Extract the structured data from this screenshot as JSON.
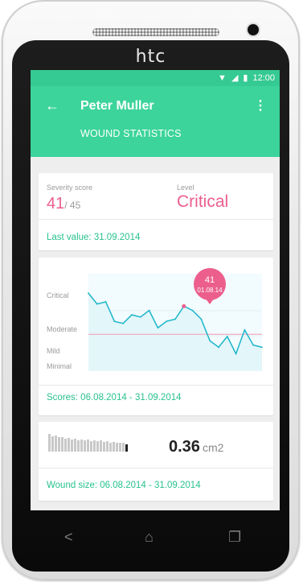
{
  "device": {
    "brand": "htc"
  },
  "status_bar": {
    "time": "12:00"
  },
  "app_bar": {
    "back_icon": "arrow-left-icon",
    "title": "Peter Muller",
    "subtitle": "WOUND STATISTICS",
    "menu_icon": "more-vert-icon"
  },
  "severity_card": {
    "severity_label": "Severity score",
    "score": "41",
    "score_max": "/ 45",
    "level_label": "Level",
    "level_value": "Critical",
    "footer": "Last value: 31.09.2014"
  },
  "chart_card": {
    "footer": "Scores: 06.08.2014 - 31.09.2014",
    "tooltip_value": "41",
    "tooltip_date": "01.08.14"
  },
  "chart_data": {
    "type": "area",
    "y_categories": [
      "Critical",
      "Moderate",
      "Mild",
      "Minimal"
    ],
    "ylim": [
      0,
      45
    ],
    "threshold": 17,
    "values": [
      36,
      31,
      32,
      23,
      22,
      26,
      25,
      28,
      20,
      23,
      24,
      30,
      28,
      24,
      14,
      11,
      16,
      8,
      19,
      12,
      11
    ],
    "highlight_index": 11,
    "colors": {
      "line": "#1ab6c9",
      "fill": "#e3f6fa",
      "threshold": "#f59ab3",
      "tooltip": "#ec5f8d"
    }
  },
  "wound_card": {
    "value": "0.36",
    "unit": "cm2",
    "footer": "Wound size: 06.08.2014 - 31.09.2014",
    "bars": [
      1.0,
      0.85,
      0.9,
      0.8,
      0.82,
      0.75,
      0.78,
      0.7,
      0.72,
      0.66,
      0.68,
      0.62,
      0.7,
      0.6,
      0.64,
      0.58,
      0.62,
      0.55,
      0.6,
      0.52,
      0.56,
      0.5,
      0.48,
      0.5,
      0.4
    ]
  },
  "navigation": {
    "back": "back-icon",
    "home": "home-icon",
    "recents": "recents-icon"
  }
}
